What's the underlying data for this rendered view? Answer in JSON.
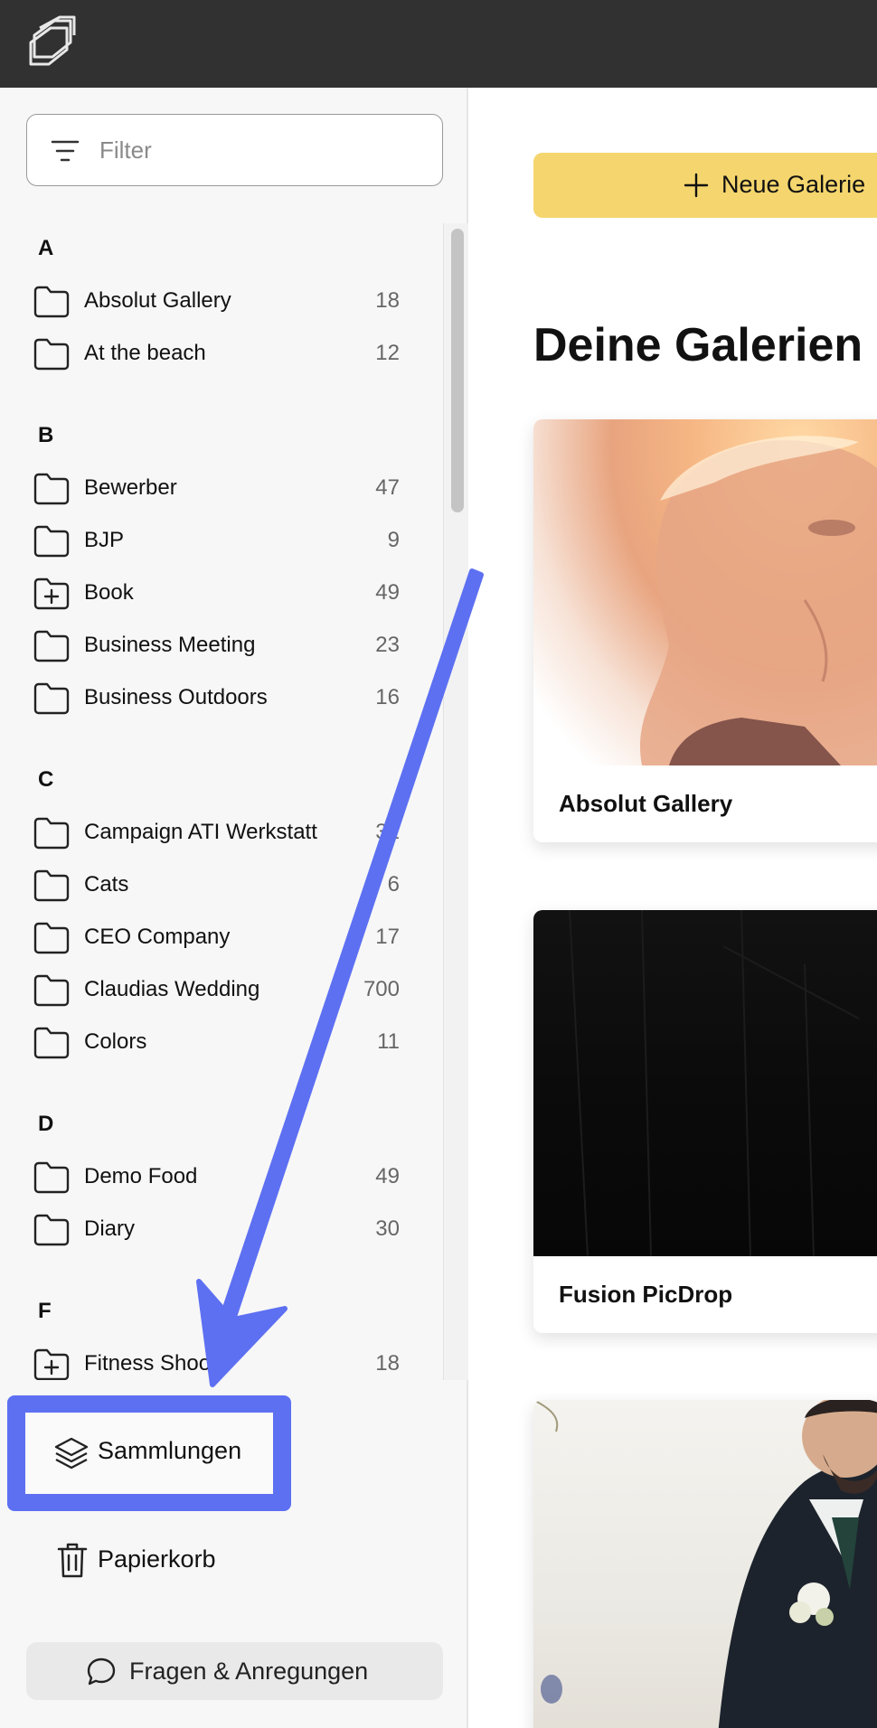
{
  "header": {
    "logo_icon": "layered-frames-logo-icon"
  },
  "sidebar": {
    "filter": {
      "placeholder": "Filter",
      "value": ""
    },
    "groups": [
      {
        "letter": "A",
        "items": [
          {
            "name": "Absolut Gallery",
            "count": "18",
            "icon": "folder-icon"
          },
          {
            "name": "At the beach",
            "count": "12",
            "icon": "folder-icon"
          }
        ]
      },
      {
        "letter": "B",
        "items": [
          {
            "name": "Bewerber",
            "count": "47",
            "icon": "folder-icon"
          },
          {
            "name": "BJP",
            "count": "9",
            "icon": "folder-icon"
          },
          {
            "name": "Book",
            "count": "49",
            "icon": "folder-plus-icon"
          },
          {
            "name": "Business Meeting",
            "count": "23",
            "icon": "folder-icon"
          },
          {
            "name": "Business Outdoors",
            "count": "16",
            "icon": "folder-icon"
          }
        ]
      },
      {
        "letter": "C",
        "items": [
          {
            "name": "Campaign ATI Werkstatt",
            "count": "31",
            "icon": "folder-icon"
          },
          {
            "name": "Cats",
            "count": "6",
            "icon": "folder-icon"
          },
          {
            "name": "CEO Company",
            "count": "17",
            "icon": "folder-icon"
          },
          {
            "name": "Claudias Wedding",
            "count": "700",
            "icon": "folder-icon"
          },
          {
            "name": "Colors",
            "count": "11",
            "icon": "folder-icon"
          }
        ]
      },
      {
        "letter": "D",
        "items": [
          {
            "name": "Demo Food",
            "count": "49",
            "icon": "folder-icon"
          },
          {
            "name": "Diary",
            "count": "30",
            "icon": "folder-icon"
          }
        ]
      },
      {
        "letter": "F",
        "items": [
          {
            "name": "Fitness Shoot",
            "count": "18",
            "icon": "folder-plus-icon"
          }
        ]
      }
    ],
    "collections_label": "Sammlungen",
    "trash_label": "Papierkorb",
    "feedback_label": "Fragen & Anregungen"
  },
  "main": {
    "new_gallery_label": "Neue Galerie",
    "title": "Deine Galerien",
    "cards": [
      {
        "title": "Absolut Gallery"
      },
      {
        "title": "Fusion PicDrop"
      },
      {
        "title": ""
      }
    ]
  },
  "annotation": {
    "arrow_color": "#5d70f2",
    "highlight_color": "#5d70f2"
  },
  "colors": {
    "topbar": "#313131",
    "accent_button": "#f5d66e",
    "sidebar_bg": "#f7f7f7"
  }
}
